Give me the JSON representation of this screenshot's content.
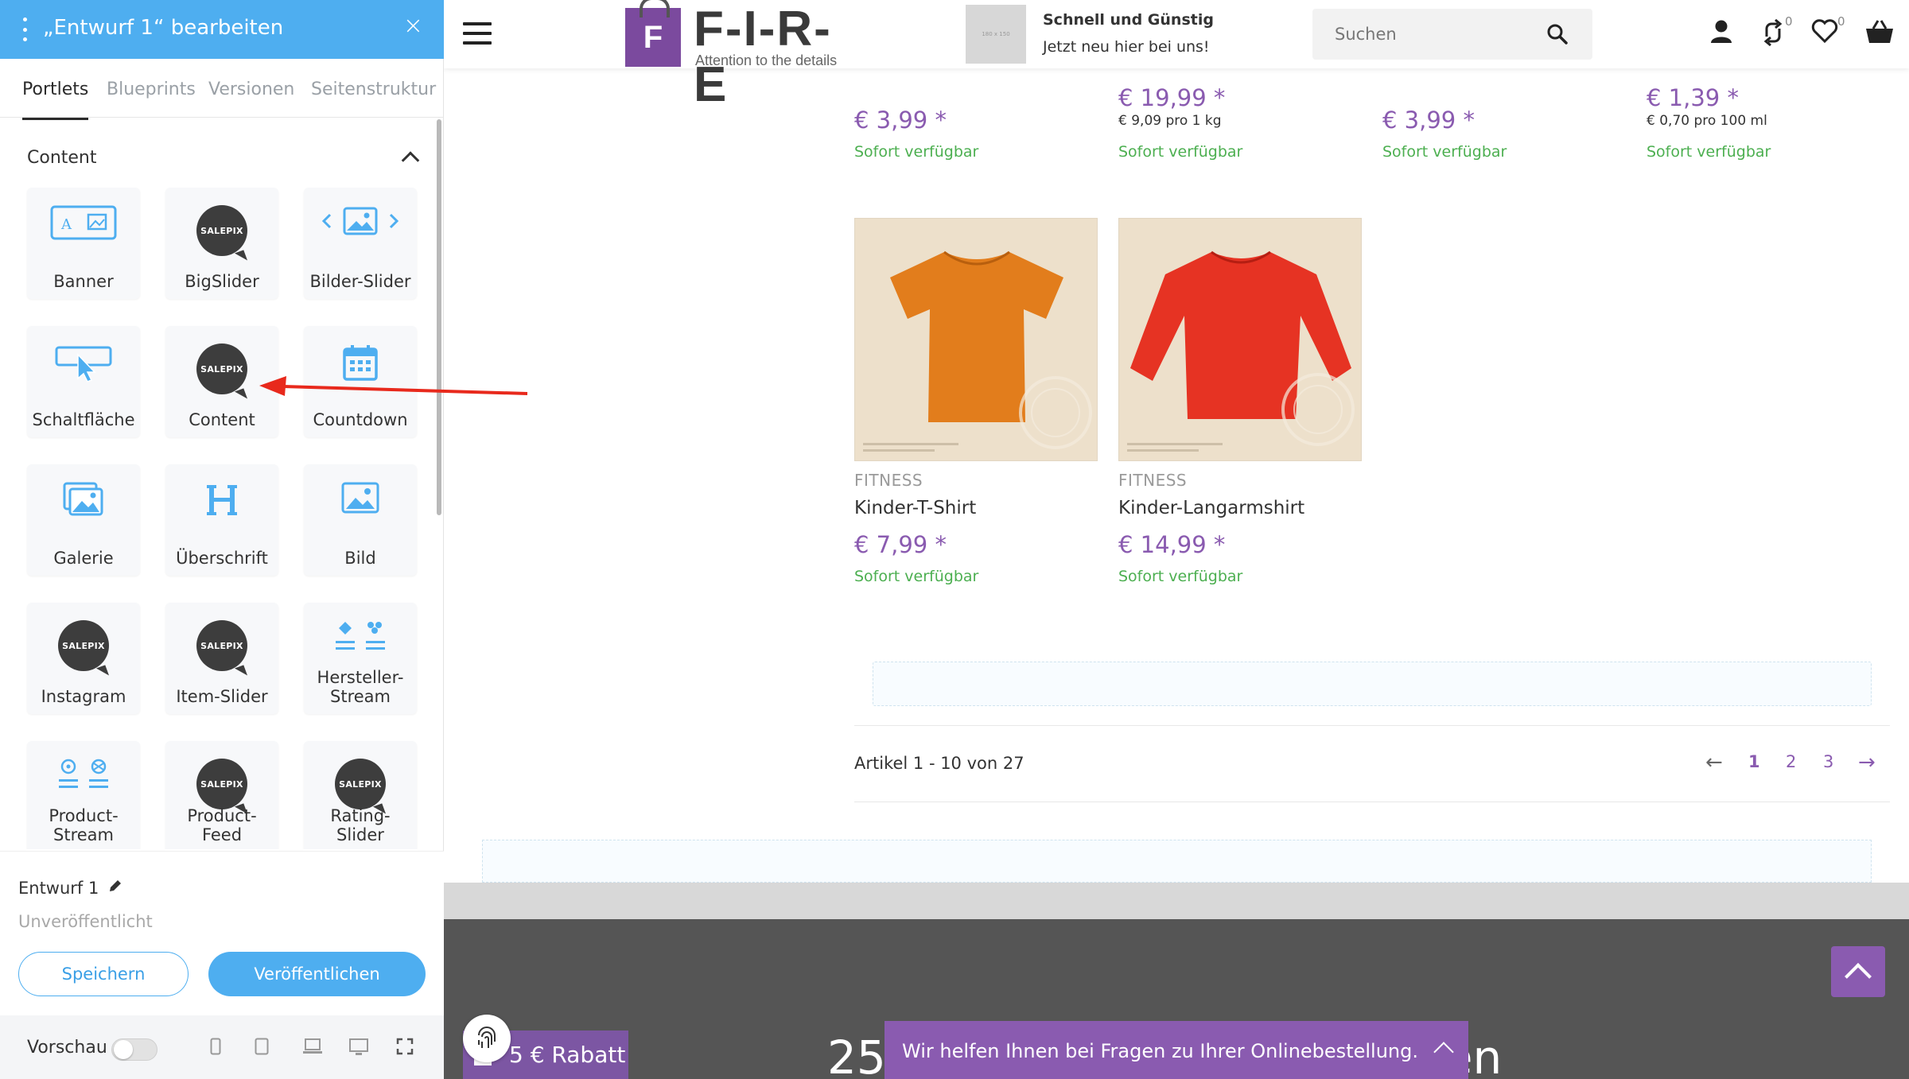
{
  "editor": {
    "title": "„Entwurf 1“ bearbeiten",
    "close": "×",
    "tabs": [
      "Portlets",
      "Blueprints",
      "Versionen",
      "Seitenstruktur"
    ],
    "section": "Content",
    "tiles": [
      {
        "label": "Banner",
        "icon": "banner-icon"
      },
      {
        "label": "BigSlider",
        "icon": "salepix-icon"
      },
      {
        "label": "Bilder-Slider",
        "icon": "image-slider-icon"
      },
      {
        "label": "Schaltfläche",
        "icon": "button-icon"
      },
      {
        "label": "Content",
        "icon": "salepix-icon"
      },
      {
        "label": "Countdown",
        "icon": "calendar-icon"
      },
      {
        "label": "Galerie",
        "icon": "gallery-icon"
      },
      {
        "label": "Überschrift",
        "icon": "heading-icon"
      },
      {
        "label": "Bild",
        "icon": "image-icon"
      },
      {
        "label": "Instagram",
        "icon": "salepix-icon"
      },
      {
        "label": "Item-Slider",
        "icon": "salepix-icon"
      },
      {
        "label": "Hersteller-\nStream",
        "icon": "manufacturer-stream-icon"
      },
      {
        "label": "Product-\nStream",
        "icon": "product-stream-icon"
      },
      {
        "label": "Product-\nFeed",
        "icon": "salepix-icon"
      },
      {
        "label": "Rating-\nSlider",
        "icon": "salepix-icon"
      }
    ],
    "salepix_text": "SALEPIX",
    "draft_name": "Entwurf 1",
    "draft_status": "Unveröffentlicht",
    "save_label": "Speichern",
    "publish_label": "Veröffentlichen",
    "preview_label": "Vorschau",
    "accent_color": "#4eaef0"
  },
  "store": {
    "logo_letter": "F",
    "logo_text": "F-I-R-E",
    "logo_tagline": "Attention to the details",
    "promo_thumb": "180 x 150",
    "promo_title": "Schnell und Günstig",
    "promo_sub": "Jetzt neu hier bei uns!",
    "search_placeholder": "Suchen",
    "compare_count": "0",
    "wishlist_count": "0",
    "brand_color": "#8a5bb0"
  },
  "top_row": [
    {
      "price": "€ 3,99 *",
      "unit": "",
      "availability": "Sofort verfügbar"
    },
    {
      "price": "€ 19,99 *",
      "unit": "€ 9,09 pro 1 kg",
      "availability": "Sofort verfügbar"
    },
    {
      "price": "€ 3,99 *",
      "unit": "",
      "availability": "Sofort verfügbar"
    },
    {
      "price": "€ 1,39 *",
      "unit": "€ 0,70 pro 100 ml",
      "availability": "Sofort verfügbar"
    }
  ],
  "products": [
    {
      "category": "FITNESS",
      "name": "Kinder-T-Shirt",
      "price": "€ 7,99 *",
      "availability": "Sofort verfügbar",
      "color": "#e27d1c"
    },
    {
      "category": "FITNESS",
      "name": "Kinder-Langarmshirt",
      "price": "€ 14,99 *",
      "availability": "Sofort verfügbar",
      "color": "#e63323"
    }
  ],
  "pagination": {
    "summary": "Artikel  1 - 10 von 27",
    "prev": "←",
    "pages": [
      "1",
      "2",
      "3"
    ],
    "next": "→"
  },
  "footer": {
    "rabatt": "5 € Rabatt",
    "banner_left": "25",
    "banner_right": "en",
    "chat_text": "Wir helfen Ihnen bei Fragen zu Ihrer Onlinebestellung."
  }
}
